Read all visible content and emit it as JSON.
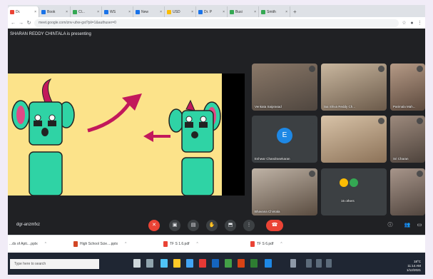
{
  "browser": {
    "tabs": [
      {
        "label": "Dr.",
        "active": true,
        "favicon_color": "#ea4335"
      },
      {
        "label": "Book",
        "active": false,
        "favicon_color": "#1a73e8"
      },
      {
        "label": "Cl...",
        "active": false,
        "favicon_color": "#34a853"
      },
      {
        "label": "WS",
        "active": false,
        "favicon_color": "#1a73e8"
      },
      {
        "label": "New",
        "active": false,
        "favicon_color": "#1a73e8"
      },
      {
        "label": "USD",
        "active": false,
        "favicon_color": "#fbbc04"
      },
      {
        "label": "Dr. P",
        "active": false,
        "favicon_color": "#1a73e8"
      },
      {
        "label": "Busi",
        "active": false,
        "favicon_color": "#34a853"
      },
      {
        "label": "Smith",
        "active": false,
        "favicon_color": "#34a853"
      }
    ],
    "new_tab": "+",
    "url": "meet.google.com/znv-ufxe-gst?pli=1&authuser=0"
  },
  "meet": {
    "presenting_text": "SHARAN REDDY CHINTALA is presenting",
    "participants": [
      {
        "name": "Venkata Saiprasad",
        "kind": "video"
      },
      {
        "name": "Sai Shiva Reddy Ch...",
        "kind": "video"
      },
      {
        "name": "Parimala Mah...",
        "kind": "video"
      },
      {
        "name": "Eshwar Chandrasekaran",
        "kind": "avatar",
        "initial": "E",
        "avatar_color": "#1e88e5"
      },
      {
        "name": "",
        "kind": "video"
      },
      {
        "name": "Sri Charan",
        "kind": "video"
      },
      {
        "name": "Bhavana Chintala",
        "kind": "video"
      },
      {
        "name": "15 others",
        "kind": "others"
      },
      {
        "name": "",
        "kind": "video"
      }
    ],
    "meeting_code": "dgr-anzmfxz",
    "controls": {
      "mic": "mic-off-icon",
      "camera": "camera-icon",
      "captions": "captions-icon",
      "hand": "raise-hand-icon",
      "present": "present-icon",
      "more": "more-icon",
      "end": "end-call-icon"
    },
    "accent_red": "#ea4335"
  },
  "downloads": [
    {
      "label": "...ds of Apti....pptx"
    },
    {
      "label": "High School Scie....pptx"
    },
    {
      "label": "TF S 1.6.pdf"
    },
    {
      "label": "TF S 6.pdf"
    }
  ],
  "taskbar": {
    "search_placeholder": "Type here to search",
    "clock_time": "11:14 AM",
    "clock_date": "1/12/2021",
    "weather": "18°C"
  }
}
